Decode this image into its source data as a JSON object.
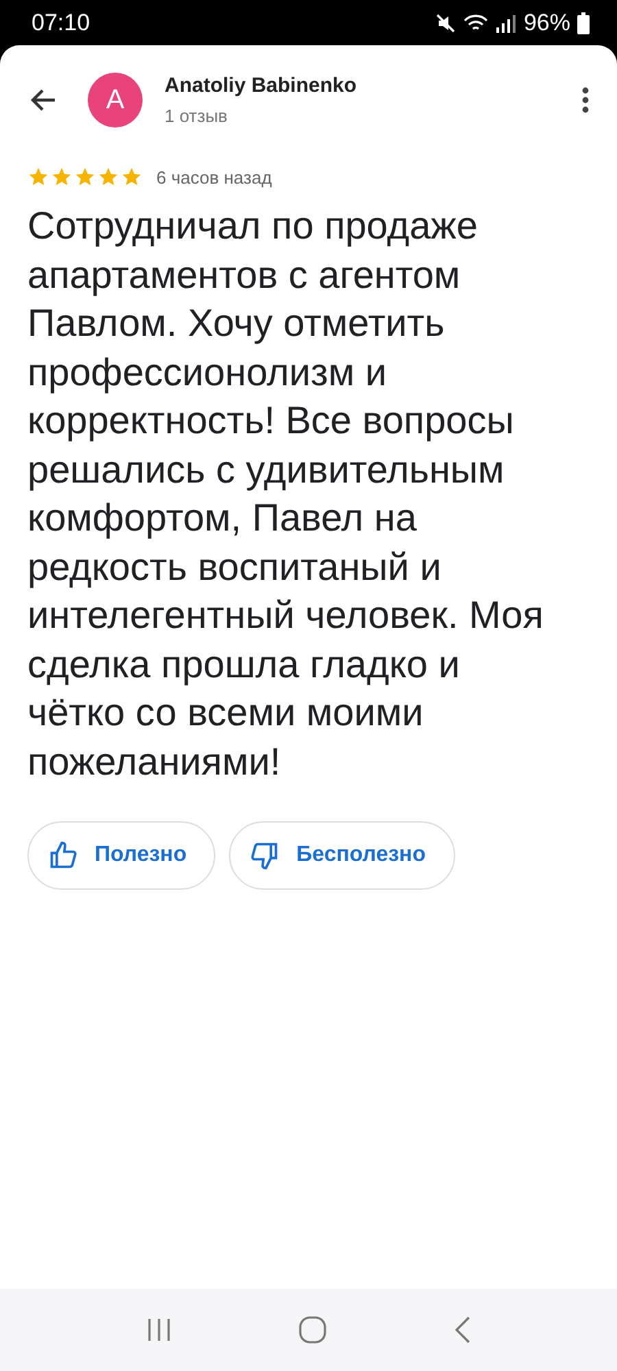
{
  "status_bar": {
    "time": "07:10",
    "battery": "96%"
  },
  "reviewer": {
    "initial": "A",
    "name": "Anatoliy Babinenko",
    "reviews": "1 отзыв"
  },
  "review": {
    "stars": 5,
    "time": "6 часов назад",
    "text": "Сотрудничал по продаже апартаментов с агентом Павлом. Хочу отметить профессионолизм и корректность! Все вопросы решались с удивительным комфортом, Павел на редкость воспитаный и интелегентный человек. Моя сделка прошла гладко и чётко со всеми моими пожеланиями!"
  },
  "buttons": [
    {
      "kind": "like",
      "label": "Полезно"
    },
    {
      "kind": "dislike",
      "label": "Бесполезно"
    }
  ]
}
